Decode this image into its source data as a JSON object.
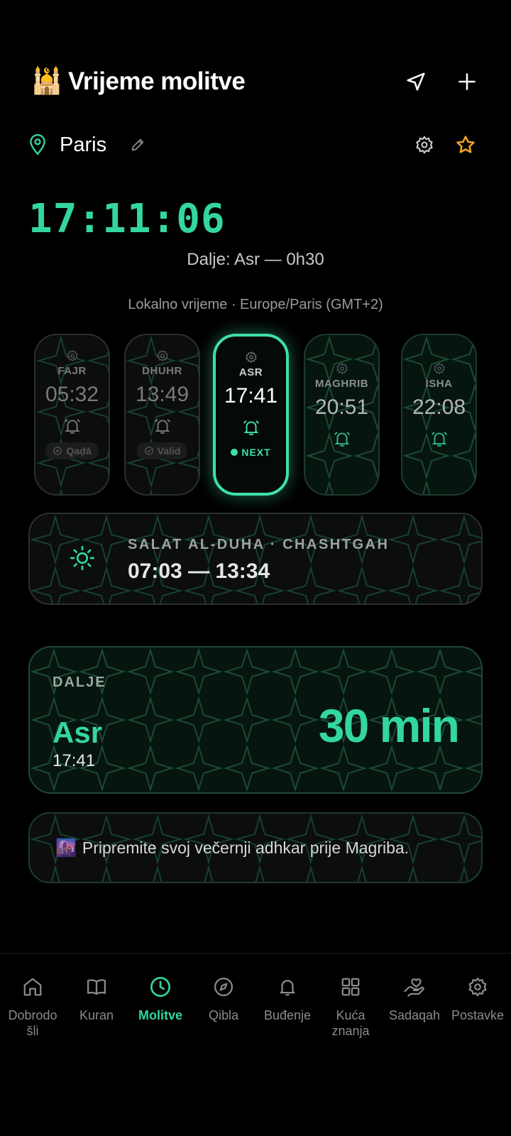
{
  "header": {
    "emoji": "🕌",
    "title": "Vrijeme molitve"
  },
  "location": {
    "city": "Paris"
  },
  "clock": {
    "time": "17:11:06"
  },
  "next_summary": "Dalje: Asr — 0h30",
  "timezone_line": "Lokalno vrijeme · Europe/Paris (GMT+2)",
  "prayers": [
    {
      "name": "FAJR",
      "time": "05:32",
      "status": "Qaḍā"
    },
    {
      "name": "DHUHR",
      "time": "13:49",
      "status": "Valid"
    },
    {
      "name": "ASR",
      "time": "17:41",
      "status": "NEXT"
    },
    {
      "name": "MAGHRIB",
      "time": "20:51"
    },
    {
      "name": "ISHA",
      "time": "22:08"
    }
  ],
  "duha": {
    "label": "SALAT AL-DUHA · CHASHTGAH",
    "range": "07:03 — 13:34"
  },
  "next": {
    "label": "DALJE",
    "name": "Asr",
    "time": "17:41",
    "countdown": "30 min"
  },
  "tip": {
    "emoji": "🌆",
    "text": "Pripremite svoj večernji adhkar prije Magriba."
  },
  "nav": [
    {
      "label": "Dobrodo\nšli",
      "icon": "home-icon"
    },
    {
      "label": "Kuran",
      "icon": "book-icon"
    },
    {
      "label": "Molitve",
      "icon": "clock-icon",
      "active": true
    },
    {
      "label": "Qibla",
      "icon": "compass-icon"
    },
    {
      "label": "Buđenje",
      "icon": "bell-icon"
    },
    {
      "label": "Kuća\nznanja",
      "icon": "grid-icon"
    },
    {
      "label": "Sadaqah",
      "icon": "hand-heart-icon"
    },
    {
      "label": "Postavke",
      "icon": "gear-icon"
    }
  ],
  "colors": {
    "accent": "#33d69f",
    "star": "#f5a524"
  }
}
